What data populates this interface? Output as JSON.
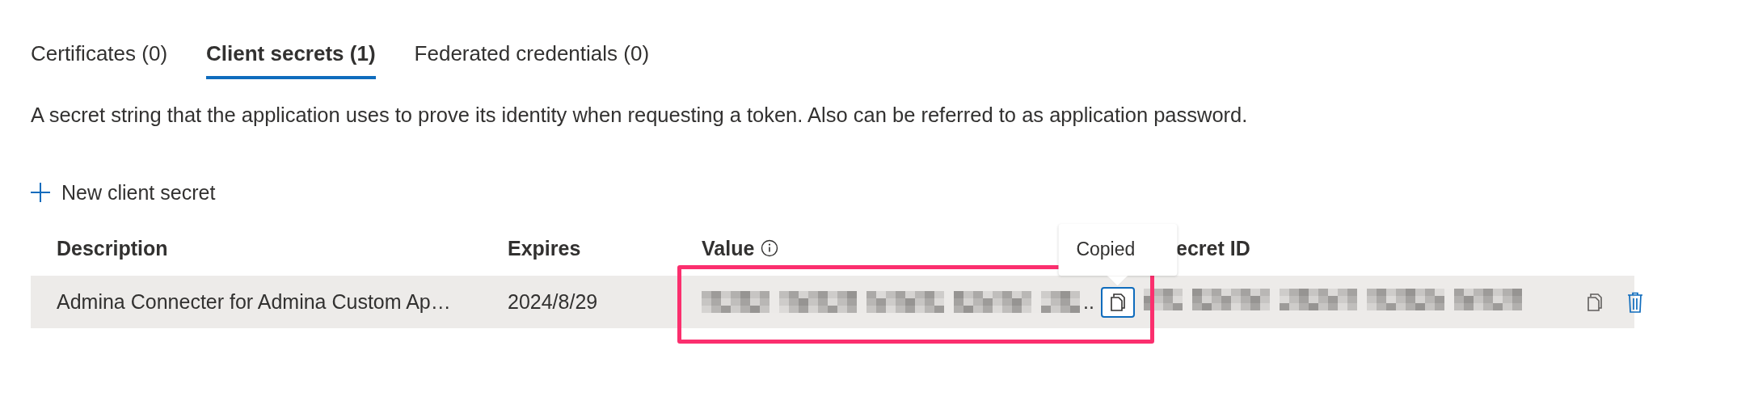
{
  "tabs": [
    {
      "label": "Certificates (0)",
      "selected": false
    },
    {
      "label": "Client secrets (1)",
      "selected": true
    },
    {
      "label": "Federated credentials (0)",
      "selected": false
    }
  ],
  "description": "A secret string that the application uses to prove its identity when requesting a token. Also can be referred to as application password.",
  "new_button": {
    "label": "New client secret"
  },
  "table": {
    "columns": [
      {
        "label": "Description",
        "info": false
      },
      {
        "label": "Expires",
        "info": false
      },
      {
        "label": "Value",
        "info": true
      },
      {
        "label": "ecret ID",
        "info": false
      }
    ],
    "rows": [
      {
        "description": "Admina Connecter for Admina Custom Ap…",
        "expires": "2024/8/29",
        "value_ellipsis": "..",
        "value_highlighted": true,
        "copy_focused": true
      }
    ]
  },
  "tooltip": {
    "text": "Copied"
  }
}
